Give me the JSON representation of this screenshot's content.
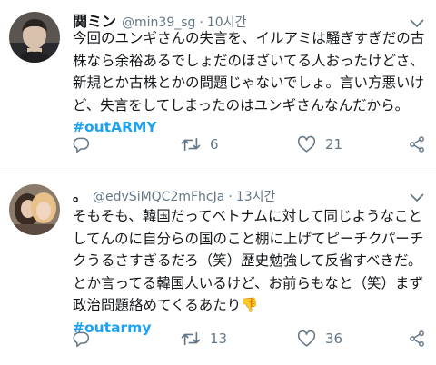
{
  "tweets": [
    {
      "name": "関ミン",
      "handle": "@min39_sg",
      "separator": "·",
      "time": "10시간",
      "lines": [
        "今回のユンギさんの失言を、イルアミは騒ぎすぎだの古",
        "株なら余裕あるでしょだのほざいてる人おったけどさ、",
        "新規とか古株とかの問題じゃないでしょ。言い方悪いけ",
        "ど、失言をしてしまったのはユンギさんなんだから。"
      ],
      "hashtag": "#outARMY",
      "retweets": "6",
      "likes": "21"
    },
    {
      "name": "。",
      "handle": "@edvSiMQC2mFhcJa",
      "separator": "·",
      "time": "13시간",
      "lines": [
        "そもそも、韓国だってベトナムに対して同じようなこと",
        "してんのに自分らの国のこと棚に上げてピーチクパーチ",
        "クうるさすぎるだろ（笑）歴史勉強して反省すべきだ。",
        "とか言ってる韓国人いるけど、お前らもなと（笑）まず",
        "政治問題絡めてくるあたり👎"
      ],
      "hashtag": "#outarmy",
      "retweets": "13",
      "likes": "36"
    }
  ],
  "icons": {
    "more": "chevron-down-icon",
    "reply": "reply-icon",
    "retweet": "retweet-icon",
    "like": "heart-icon",
    "share": "share-icon"
  },
  "colors": {
    "hashtag": "#1da1f2",
    "secondary_text": "#657786",
    "divider": "#e1e8ed"
  }
}
